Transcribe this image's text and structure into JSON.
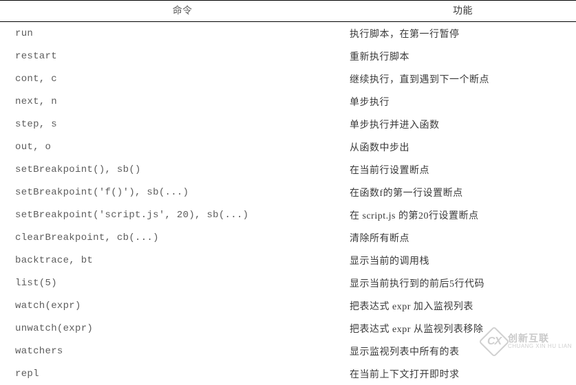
{
  "headers": {
    "command": "命令",
    "function": "功能"
  },
  "rows": [
    {
      "cmd": "run",
      "fn": "执行脚本，在第一行暂停"
    },
    {
      "cmd": "restart",
      "fn": "重新执行脚本"
    },
    {
      "cmd": "cont, c",
      "fn": "继续执行，直到遇到下一个断点"
    },
    {
      "cmd": "next, n",
      "fn": "单步执行"
    },
    {
      "cmd": "step, s",
      "fn": "单步执行并进入函数"
    },
    {
      "cmd": "out, o",
      "fn": "从函数中步出"
    },
    {
      "cmd": "setBreakpoint(), sb()",
      "fn": "在当前行设置断点"
    },
    {
      "cmd": "setBreakpoint('f()'), sb(...)",
      "fn": "在函数f的第一行设置断点"
    },
    {
      "cmd": "setBreakpoint('script.js', 20), sb(...)",
      "fn": "在 script.js 的第20行设置断点"
    },
    {
      "cmd": "clearBreakpoint, cb(...)",
      "fn": "清除所有断点"
    },
    {
      "cmd": "backtrace, bt",
      "fn": "显示当前的调用栈"
    },
    {
      "cmd": "list(5)",
      "fn": "显示当前执行到的前后5行代码"
    },
    {
      "cmd": "watch(expr)",
      "fn": "把表达式 expr 加入监视列表"
    },
    {
      "cmd": "unwatch(expr)",
      "fn": "把表达式 expr 从监视列表移除"
    },
    {
      "cmd": "watchers",
      "fn": "显示监视列表中所有的表"
    },
    {
      "cmd": "repl",
      "fn": "在当前上下文打开即时求"
    }
  ],
  "watermark": {
    "badge": "CX",
    "cn": "创新互联",
    "en": "CHUANG XIN HU LIAN"
  }
}
